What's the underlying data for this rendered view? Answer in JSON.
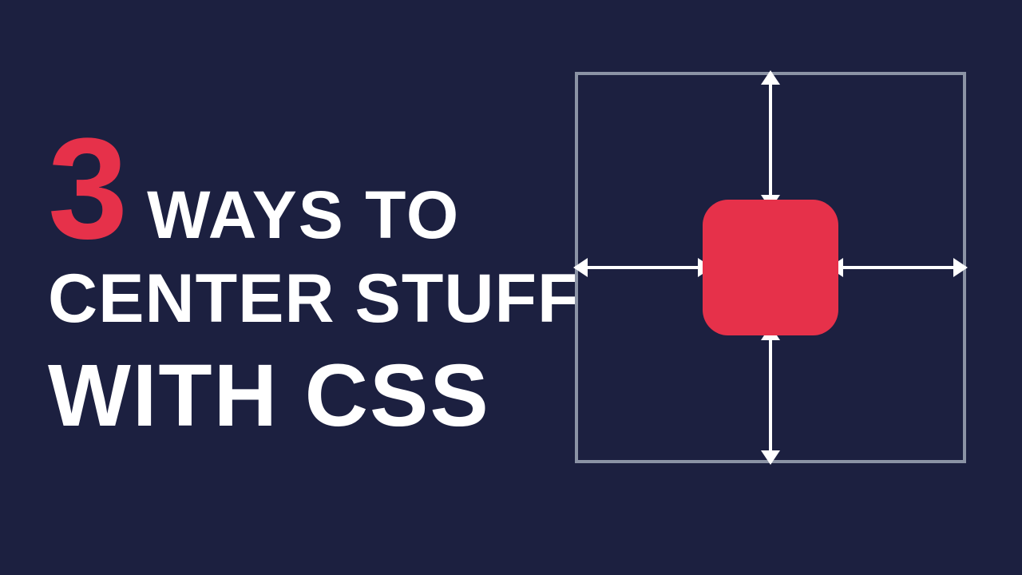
{
  "title": {
    "number": "3",
    "line1": "WAYS TO",
    "line2": "CENTER STUFF",
    "line3": "WITH CSS"
  },
  "colors": {
    "background": "#1c2040",
    "accent": "#e6314a",
    "text": "#ffffff",
    "border": "#8b93a5"
  }
}
